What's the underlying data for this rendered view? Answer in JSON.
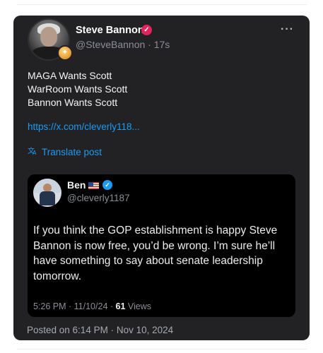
{
  "author": {
    "name": "Steve Bannon",
    "handle_line": "@SteveBannon · 17s"
  },
  "post": {
    "lines": [
      "MAGA Wants Scott",
      "WarRoom Wants Scott",
      "Bannon Wants Scott"
    ],
    "link": "https://x.com/cleverly118...",
    "translate_label": "Translate post",
    "posted_on": "Posted on 6:14 PM · Nov 10, 2024"
  },
  "quote": {
    "name": "Ben",
    "handle": "@cleverly1187",
    "lines": [
      "If you think the GOP establishment is happy Steve",
      "Bannon is now free, you’d be wrong. I’m sure he’ll",
      "have something to say about senate leadership",
      "tomorrow."
    ],
    "meta_prefix": "5:26 PM · 11/10/24 · ",
    "views_count": "61",
    "views_label": " Views"
  },
  "icons": {
    "more": "more-horizontal-icon",
    "verified_author": "verified-badge-icon",
    "verified_quote": "verified-badge-icon",
    "translate": "translate-icon",
    "flag": "us-flag-icon"
  },
  "colors": {
    "card_bg": "#222225",
    "link": "#1d9bf0",
    "verified_red": "#e0245e",
    "verified_blue": "#1d9bf0",
    "muted": "#8b8f94"
  }
}
